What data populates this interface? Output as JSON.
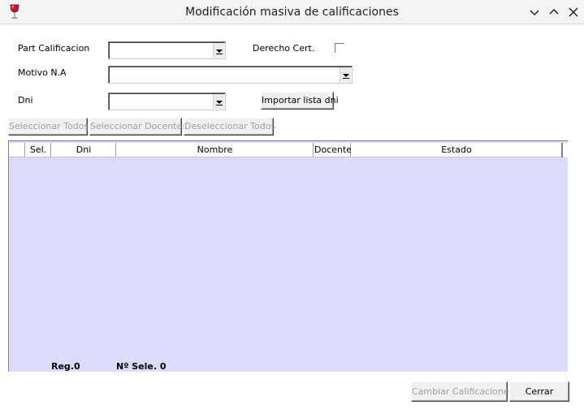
{
  "window": {
    "title": "Modificación masiva de calificaciones",
    "app_icon": "wine-glass-icon"
  },
  "form": {
    "part_calificacion_label": "Part Calificacion",
    "part_calificacion_value": "",
    "derecho_cert_label": "Derecho Cert.",
    "derecho_cert_checked": false,
    "motivo_label": "Motivo N.A",
    "motivo_value": "",
    "dni_label": "Dni",
    "dni_value": "",
    "importar_label": "Importar lista dni"
  },
  "selection_buttons": {
    "select_all": "Seleccionar Todos",
    "select_teachers": "Seleccionar Docentes",
    "deselect_all": "Deseleccionar Todos"
  },
  "grid": {
    "columns": [
      "Sel.",
      "Dni",
      "Nombre",
      "Docente",
      "Estado"
    ],
    "rows": []
  },
  "status": {
    "reg": "Reg.0",
    "sele": "Nº Sele. 0"
  },
  "actions": {
    "cambiar": "Cambiar Calificaciones",
    "cerrar": "Cerrar"
  },
  "colors": {
    "grid_background": "#dcdcfa",
    "titlebar": "#f4f4f4"
  }
}
